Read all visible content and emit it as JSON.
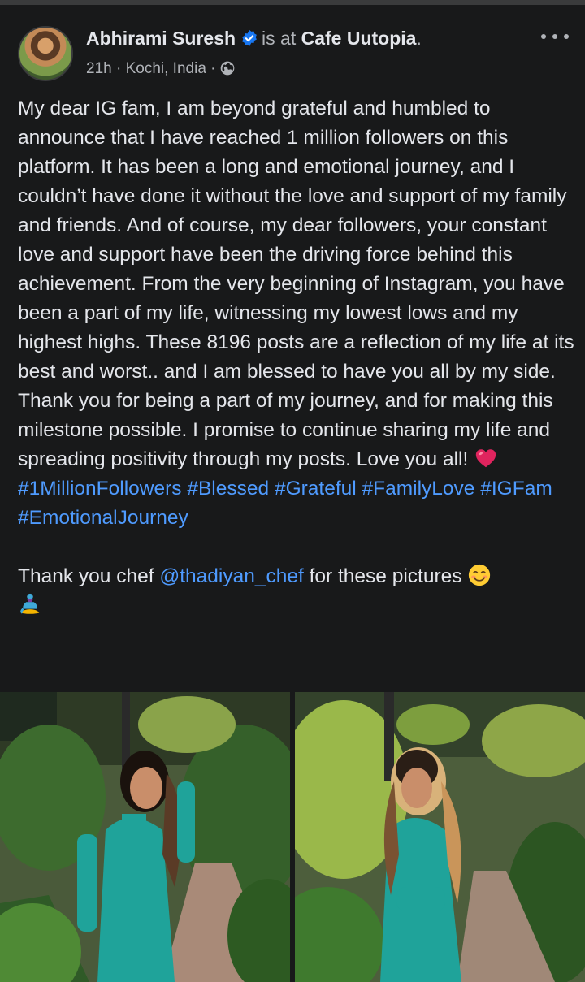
{
  "header": {
    "author": "Abhirami Suresh",
    "is_at": "is at",
    "place": "Cafe Uutopia",
    "place_suffix": ".",
    "time": "21h",
    "separator": "·",
    "location": "Kochi, India",
    "separator2": "·"
  },
  "post": {
    "body": "My dear IG fam, I am beyond grateful and humbled to announce that I have reached 1 million followers on this platform. It has been a long and emotional journey, and I couldn’t have done it without the love and support of my family and friends. And of course, my dear followers, your constant love and support have been the driving force behind this achievement. From the very beginning of Instagram, you have been a part of my life, witnessing my lowest lows and my highest highs. These 8196 posts are a reflection of my life at its best and worst.. and I am blessed to have you all by my side. Thank you for being a part of my journey, and for making this milestone possible. I promise to continue sharing my life and spreading positivity through my posts. Love you all!",
    "hashtags": [
      "#1MillionFollowers",
      "#Blessed",
      "#Grateful",
      "#FamilyLove",
      "#IGFam",
      "#EmotionalJourney"
    ],
    "thanks_prefix": "Thank you chef ",
    "mention": "@thadiyan_chef",
    "thanks_suffix": " for these pictures"
  },
  "icons": {
    "verified": "verified-badge-icon",
    "globe": "globe-icon",
    "more": "more-options-icon",
    "heart": "red-heart-emoji",
    "smile": "smiling-face-emoji",
    "genie": "genie-emoji"
  },
  "colors": {
    "background": "#18191a",
    "text": "#e4e6eb",
    "secondary": "#b0b3b8",
    "link": "#4f9bff",
    "verified": "#1877f2",
    "heart": "#e0245e"
  }
}
